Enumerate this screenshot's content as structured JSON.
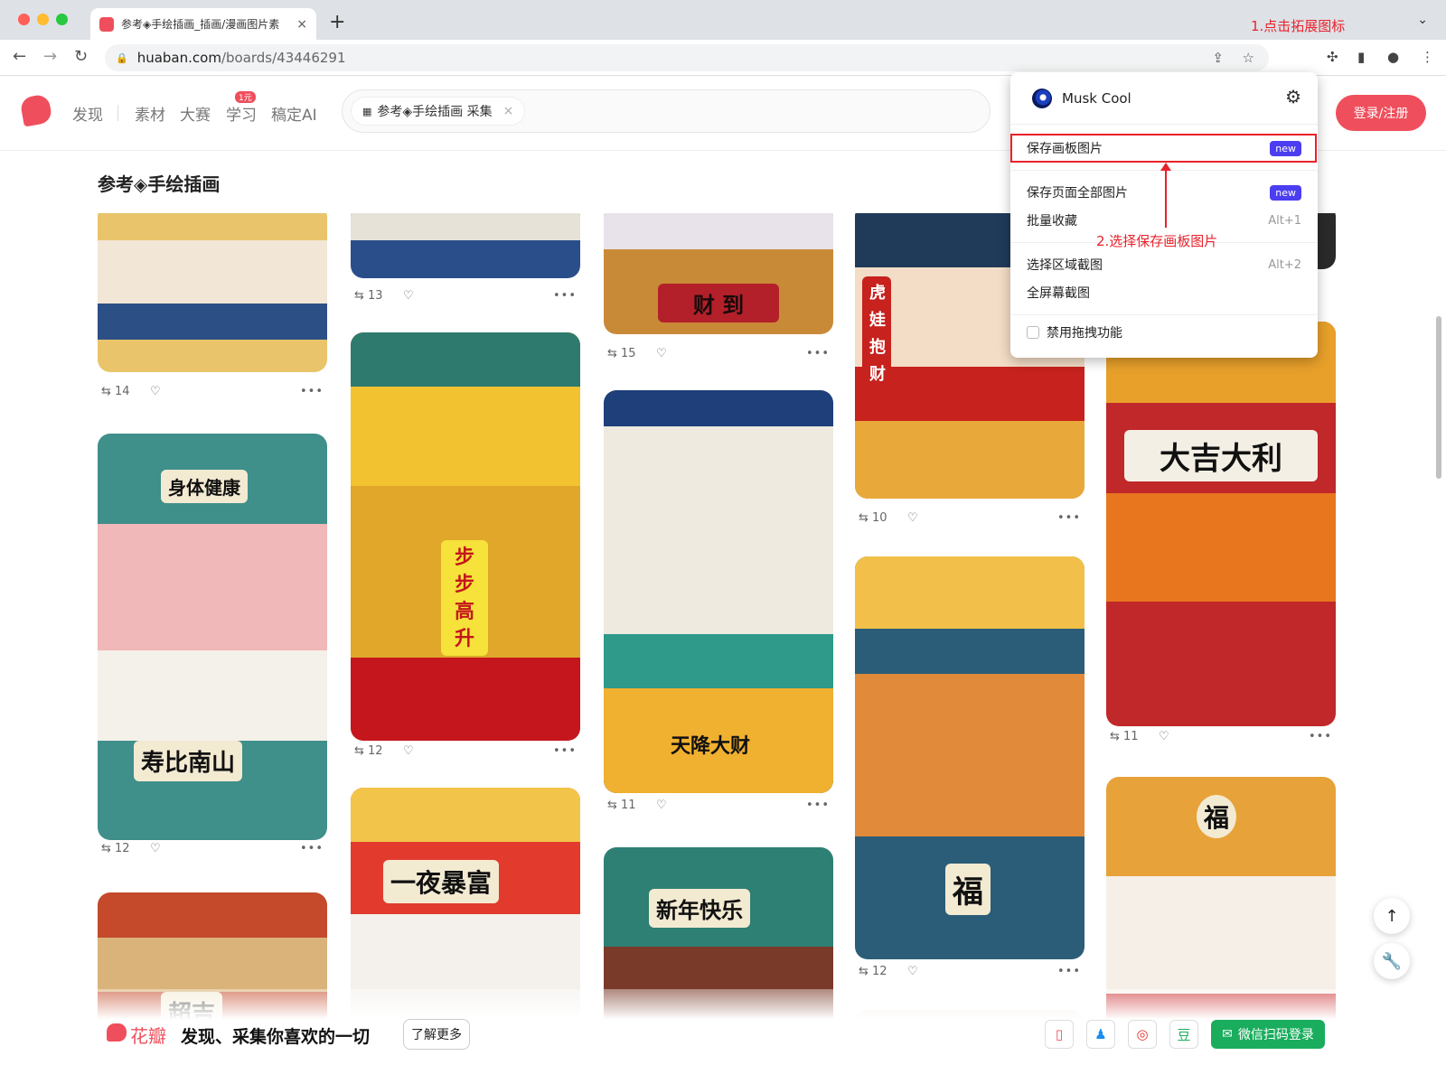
{
  "browser": {
    "tab_title": "参考◈手绘插画_插画/漫画图片素",
    "tab_close": "×",
    "new_tab": "+",
    "url_host": "huaban.com",
    "url_path": "/boards/43446291",
    "annotation_1": "1.点击拓展图标",
    "annotation_2": "2.选择保存画板图片"
  },
  "site": {
    "nav": [
      "发现",
      "素材",
      "大赛",
      "学习",
      "稿定AI"
    ],
    "learn_badge": "1元",
    "search_chip": "参考◈手绘插画 采集",
    "search_chip_close": "×",
    "login_button": "登录/注册"
  },
  "board": {
    "title": "参考◈手绘插画"
  },
  "extension_popup": {
    "name": "Musk Cool",
    "items": [
      {
        "label": "保存画板图片",
        "badge": "new"
      },
      {
        "label": "保存页面全部图片",
        "badge": "new"
      },
      {
        "label": "批量收藏",
        "shortcut": "Alt+1"
      },
      {
        "label": "选择区域截图",
        "shortcut": "Alt+2"
      },
      {
        "label": "全屏幕截图"
      },
      {
        "label": "禁用拖拽功能"
      }
    ]
  },
  "pins": [
    {
      "repins": "14"
    },
    {
      "repins": "12",
      "caption": "寿比南山"
    },
    {
      "repins": "13"
    },
    {
      "repins": "12",
      "caption": "步步高升"
    },
    {
      "caption": "一夜暴富"
    },
    {
      "repins": "15",
      "caption": "财 到"
    },
    {
      "repins": "11",
      "caption": "天降大财"
    },
    {
      "caption": "新年快乐"
    },
    {
      "repins": "10",
      "caption": "虎娃抱财"
    },
    {
      "repins": "12",
      "caption": "福"
    },
    {
      "repins": "11",
      "caption": "大吉大利"
    },
    {
      "caption": "福"
    },
    {
      "caption": "身体健康"
    },
    {
      "caption": "超吉"
    }
  ],
  "bottom_bar": {
    "brand": "花瓣",
    "slogan": "发现、采集你喜欢的一切",
    "learn_more": "了解更多",
    "wechat_login": "微信扫码登录"
  },
  "colors": {
    "accent": "#ef4f5c",
    "annotation": "#e8222b",
    "new_badge": "#4b3df0",
    "wechat": "#1aad5d"
  }
}
